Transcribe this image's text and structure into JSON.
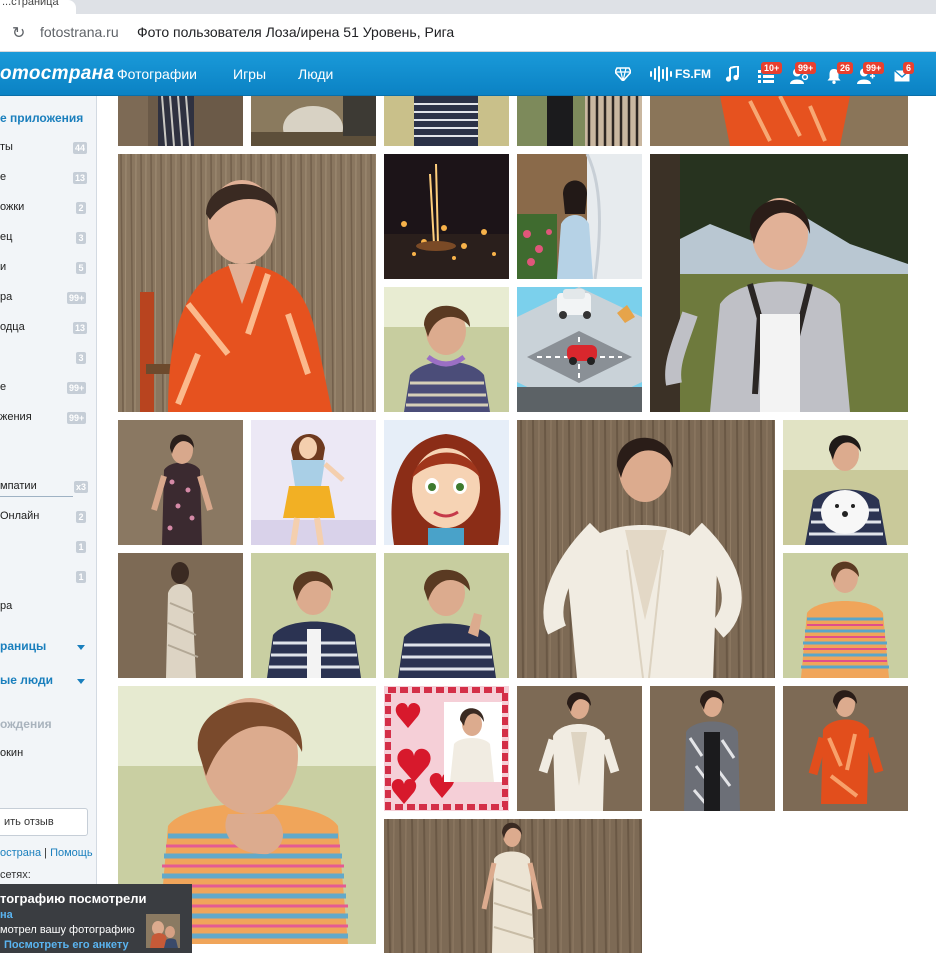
{
  "browser": {
    "tab_text": "...стрaницa",
    "url_domain": "fotostrana.ru",
    "page_title": "Фото пользователя Лоза/ирена 51 Уровень, Рига"
  },
  "header": {
    "logo": "ото­страна",
    "nav": [
      "Фотографии",
      "Игры",
      "Люди"
    ],
    "fsfm_label": "FS.FM",
    "badges": {
      "feed": "10+",
      "guests": "99+",
      "notifications": "26",
      "friends": "99+",
      "messages": "6"
    }
  },
  "sidebar": {
    "section_title": "е приложения",
    "items": [
      {
        "label": "ты",
        "count": "44"
      },
      {
        "label": "е",
        "count": "13"
      },
      {
        "label": "ожки",
        "count": "2"
      },
      {
        "label": "ец",
        "count": "3"
      },
      {
        "label": "и",
        "count": "5"
      },
      {
        "label": "ра",
        "count": "99+"
      },
      {
        "label": "одца",
        "count": "13"
      },
      {
        "label": "",
        "count": "3"
      },
      {
        "label": "е",
        "count": "99+"
      },
      {
        "label": "жения",
        "count": "99+"
      }
    ],
    "sympathy_label": "мпатии",
    "sympathy_count": "x3",
    "online_items": [
      {
        "label": "Онлайн",
        "count": "2"
      },
      {
        "label": "",
        "count": "1"
      },
      {
        "label": "",
        "count": "1"
      }
    ],
    "extra_item": "ра",
    "pages_label": "раницы",
    "people_label": "ые люди",
    "birthdays_label": "ождения",
    "birthday_name": "окин",
    "review_button": "ить отзыв",
    "footer_link1": "острана",
    "footer_sep": "|",
    "footer_link2": "Помощь",
    "networks_label": "сетях:"
  },
  "toast": {
    "title": "тографию посмотрели",
    "name": "на",
    "text": "мотрел вашу фотографию",
    "link": "Посмотреть его анкету"
  },
  "photos": [
    {
      "id": "p01",
      "theme": "woman-patterned"
    },
    {
      "id": "p02",
      "theme": "woman-sitting-light"
    },
    {
      "id": "p03",
      "theme": "woman-striped"
    },
    {
      "id": "p04",
      "theme": "woman-balcony"
    },
    {
      "id": "p05",
      "theme": "woman-orange"
    },
    {
      "id": "p06",
      "theme": "woman-orange-large"
    },
    {
      "id": "p07",
      "theme": "fountain-night"
    },
    {
      "id": "p08",
      "theme": "woman-window-flowers"
    },
    {
      "id": "p09",
      "theme": "woman-forest-large"
    },
    {
      "id": "p10",
      "theme": "woman-webcam-sweater"
    },
    {
      "id": "p11",
      "theme": "cartoon-cars-street"
    },
    {
      "id": "p12",
      "theme": "woman-floral-dress"
    },
    {
      "id": "p13",
      "theme": "cartoon-girl-yellow-skirt"
    },
    {
      "id": "p14",
      "theme": "cartoon-redhead"
    },
    {
      "id": "p15",
      "theme": "woman-white-jacket-large"
    },
    {
      "id": "p16",
      "theme": "woman-with-dog"
    },
    {
      "id": "p17",
      "theme": "woman-lace-dress-back"
    },
    {
      "id": "p18",
      "theme": "woman-striped-jacket"
    },
    {
      "id": "p19",
      "theme": "woman-striped-smiling"
    },
    {
      "id": "p20",
      "theme": "woman-striped-cardigan"
    },
    {
      "id": "p21",
      "theme": "woman-closeup-large"
    },
    {
      "id": "p22",
      "theme": "valentine-collage"
    },
    {
      "id": "p23",
      "theme": "woman-white-jacket"
    },
    {
      "id": "p24",
      "theme": "woman-grey-jacket"
    },
    {
      "id": "p25",
      "theme": "woman-orange-jacket"
    },
    {
      "id": "p26",
      "theme": "woman-lace-dress"
    }
  ],
  "colors": {
    "header_blue": "#1a9ad9",
    "sidebar_bg": "#f2f5f8",
    "link_blue": "#1a7fbd",
    "badge_red": "#e8402f"
  }
}
